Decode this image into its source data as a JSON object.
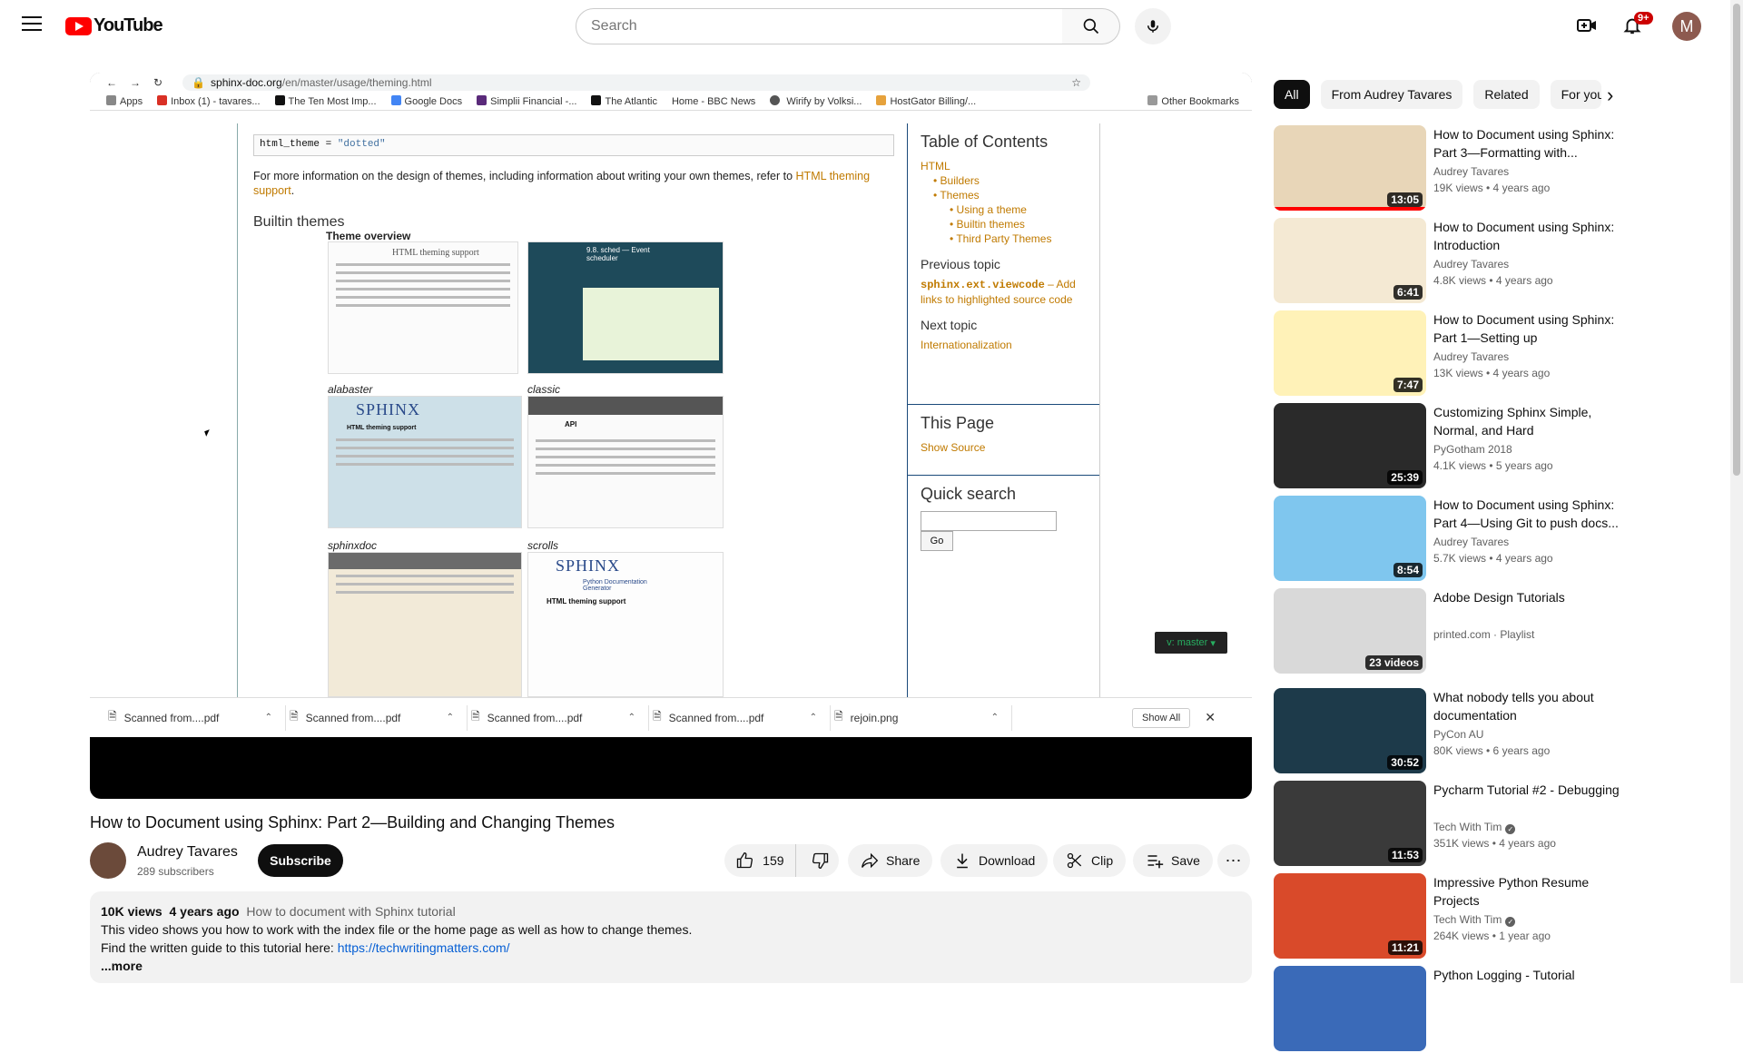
{
  "header": {
    "logo_text": "YouTube",
    "search_placeholder": "Search",
    "notification_count": "9+",
    "avatar_letter": "M"
  },
  "player": {
    "browser": {
      "url_domain": "sphinx-doc.org",
      "url_path": "/en/master/usage/theming.html",
      "bookmarks": [
        "Apps",
        "Inbox (1) - tavares...",
        "The Ten Most Imp...",
        "Google Docs",
        "Simplii Financial -...",
        "The Atlantic",
        "Home - BBC News",
        " Wirify by Volksi...",
        "HostGator Billing/...",
        "Other Bookmarks"
      ]
    },
    "doc": {
      "code": "html_theme = ",
      "code_string": "\"dotted\"",
      "para_text": "For more information on the design of themes, including information about writing your own themes, refer to ",
      "para_link": "HTML theming support",
      "builtin_heading": "Builtin themes",
      "overview_heading": "Theme overview",
      "captions": [
        "alabaster",
        "classic",
        "sphinxdoc",
        "scrolls"
      ],
      "sphinx_logo": "SPHINX",
      "thumb_small_titles": [
        "HTML theming support",
        "9.8. sched — Event scheduler",
        "API",
        "Python Documentation Generator",
        "HTML theming support"
      ]
    },
    "toc": {
      "title": "Table of Contents",
      "items": [
        "HTML",
        "Builders",
        "Themes",
        "Using a theme",
        "Builtin themes",
        "Third Party Themes"
      ],
      "prev_heading": "Previous topic",
      "prev_code": "sphinx.ext.viewcode",
      "prev_text": " – Add links to highlighted source code",
      "next_heading": "Next topic",
      "next_link": "Internationalization",
      "this_page_heading": "This Page",
      "show_source": "Show Source",
      "quick_search_heading": "Quick search",
      "go_label": "Go"
    },
    "version_badge": "v: master",
    "downloads": {
      "items": [
        "Scanned from....pdf",
        "Scanned from....pdf",
        "Scanned from....pdf",
        "Scanned from....pdf",
        "rejoin.png"
      ],
      "show_all": "Show All"
    }
  },
  "video": {
    "title": "How to Document using Sphinx: Part 2—Building and Changing Themes",
    "channel_name": "Audrey Tavares",
    "subscribers": "289 subscribers",
    "subscribe_label": "Subscribe",
    "likes": "159",
    "share_label": "Share",
    "download_label": "Download",
    "clip_label": "Clip",
    "save_label": "Save"
  },
  "description": {
    "views": "10K views",
    "age": "4 years ago",
    "playlist": "How to document with Sphinx tutorial",
    "line1": "This video shows you how to work with the index file or the home page as well as how to change themes.",
    "line2_prefix": "Find the written guide to this tutorial here: ",
    "line2_link": "https://techwritingmatters.com/",
    "more_label": "...more"
  },
  "chips": [
    "All",
    "From Audrey Tavares",
    "Related",
    "For you"
  ],
  "recommendations": [
    {
      "title": "How to Document using Sphinx: Part 3—Formatting with...",
      "channel": "Audrey Tavares",
      "stats": "19K views • 4 years ago",
      "duration": "13:05",
      "verified": false,
      "thumb_color": "#e8d6b8"
    },
    {
      "title": "How to Document using Sphinx: Introduction",
      "channel": "Audrey Tavares",
      "stats": "4.8K views • 4 years ago",
      "duration": "6:41",
      "verified": false,
      "thumb_color": "#f4e9d3"
    },
    {
      "title": "How to Document using Sphinx: Part 1—Setting up",
      "channel": "Audrey Tavares",
      "stats": "13K views • 4 years ago",
      "duration": "7:47",
      "verified": false,
      "thumb_color": "#fff2b8"
    },
    {
      "title": "Customizing Sphinx Simple, Normal, and Hard",
      "channel": "PyGotham 2018",
      "stats": "4.1K views • 5 years ago",
      "duration": "25:39",
      "verified": false,
      "thumb_color": "#2a2a2a"
    },
    {
      "title": "How to Document using Sphinx: Part 4—Using Git to push docs...",
      "channel": "Audrey Tavares",
      "stats": "5.7K views • 4 years ago",
      "duration": "8:54",
      "verified": false,
      "thumb_color": "#7fc6ee"
    },
    {
      "title": "Adobe Design Tutorials",
      "channel": "printed.com · Playlist",
      "stats": "",
      "duration": "23 videos",
      "verified": false,
      "thumb_color": "#d9d9d9"
    },
    {
      "title": "What nobody tells you about documentation",
      "channel": "PyCon AU",
      "stats": "80K views • 6 years ago",
      "duration": "30:52",
      "verified": false,
      "thumb_color": "#1d3a4a"
    },
    {
      "title": "Pycharm Tutorial #2 - Debugging",
      "channel": "Tech With Tim",
      "stats": "351K views • 4 years ago",
      "duration": "11:53",
      "verified": true,
      "thumb_color": "#3a3a3a"
    },
    {
      "title": "Impressive Python Resume Projects",
      "channel": "Tech With Tim",
      "stats": "264K views • 1 year ago",
      "duration": "11:21",
      "verified": true,
      "thumb_color": "#d94a2a"
    },
    {
      "title": "Python Logging - Tutorial",
      "channel": "",
      "stats": "",
      "duration": "",
      "verified": false,
      "thumb_color": "#3a6ab8"
    }
  ]
}
